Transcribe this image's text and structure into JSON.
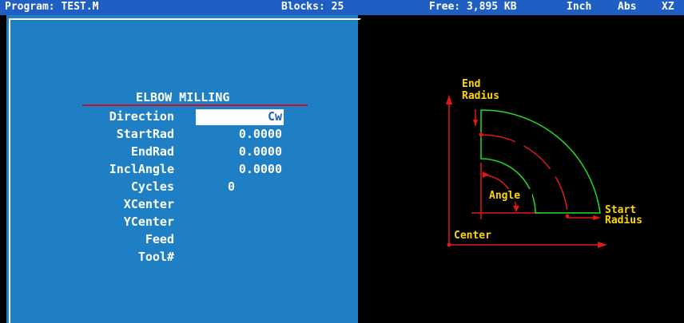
{
  "status": {
    "program": "Program: TEST.M",
    "blocks": "Blocks: 25",
    "free": "Free: 3,895 KB",
    "units": "Inch",
    "mode": "Abs",
    "plane": "XZ"
  },
  "dialog": {
    "title": "ELBOW MILLING",
    "fields": [
      {
        "label": "Direction",
        "value": "Cw"
      },
      {
        "label": "StartRad",
        "value": "0.0000"
      },
      {
        "label": "EndRad",
        "value": "0.0000"
      },
      {
        "label": "InclAngle",
        "value": "0.0000"
      },
      {
        "label": "Cycles",
        "value": "0"
      },
      {
        "label": "XCenter",
        "value": ""
      },
      {
        "label": "YCenter",
        "value": ""
      },
      {
        "label": "Feed",
        "value": ""
      },
      {
        "label": "Tool#",
        "value": ""
      }
    ]
  },
  "diagram": {
    "end_label_1": "End",
    "end_label_2": "Radius",
    "angle_label": "Angle",
    "start_label_1": "Start",
    "start_label_2": "Radius",
    "center_label": "Center"
  },
  "colors": {
    "status_bg": "#1f5fc4",
    "panel_bg": "#1f7fc4",
    "accent_red": "#c8102e",
    "arc_green": "#22dd22",
    "label_yellow": "#ffd700"
  }
}
